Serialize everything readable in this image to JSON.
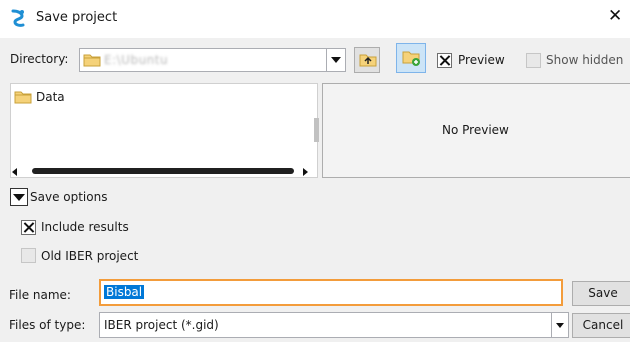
{
  "window": {
    "title": "Save project",
    "app_icon": "iber-logo-icon",
    "close_glyph": "✕"
  },
  "toolbar": {
    "directory_label": "Directory:",
    "directory_value": "E:\\Ubuntu",
    "up_folder_icon": "up-folder-icon",
    "new_folder_icon": "new-folder-icon",
    "preview_label": "Preview",
    "preview_checked": true,
    "show_hidden_label": "Show hidden",
    "show_hidden_checked": false
  },
  "file_list": {
    "items": [
      {
        "label": "Data",
        "icon": "folder-icon"
      }
    ]
  },
  "preview_panel": {
    "text": "No Preview"
  },
  "save_options": {
    "label": "Save options",
    "include_results_label": "Include results",
    "include_results_checked": true,
    "old_iber_label": "Old IBER project",
    "old_iber_checked": false
  },
  "file_name": {
    "label": "File name:",
    "value": "Bisbal"
  },
  "file_type": {
    "label": "Files of type:",
    "value": "IBER project (*.gid)"
  },
  "buttons": {
    "save": "Save",
    "cancel": "Cancel"
  },
  "colors": {
    "focus_border": "#f39c3b",
    "selection": "#0078d7",
    "logo": "#1f8fd4"
  }
}
